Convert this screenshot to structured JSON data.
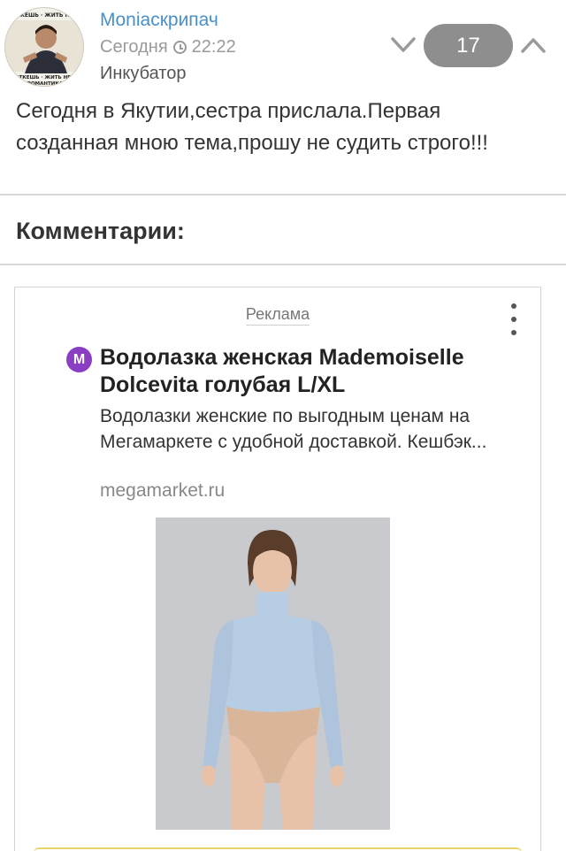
{
  "post": {
    "author": "Moniаскрипач",
    "date": "Сегодня",
    "time": "22:22",
    "community": "Инкубатор",
    "score": "17",
    "text": "Сегодня в Якутии,сестра прислала.Первая созданная мною тема,прошу не судить строго!!!",
    "avatar_caption": "ТЕОТЕКЕШЬ · ЖИТЬ НЕВОЗ. · РОМАНТИКА"
  },
  "comments": {
    "title": "Комментарии:"
  },
  "ad": {
    "label": "Реклама",
    "brand_letter": "M",
    "title": "Водолазка женская Mademoiselle Dolcevita голубая L/XL",
    "description": "Водолазки женские по выгодным ценам на Мегамаркете с удобной доставкой. Кешбэк...",
    "domain": "megamarket.ru"
  },
  "icons": {
    "vote_down": "chevron-down-icon",
    "vote_up": "chevron-up-icon",
    "clock": "clock-icon",
    "menu": "more-vertical-icon",
    "brand": "megamarket-logo-icon"
  },
  "colors": {
    "author": "#4a90c8",
    "score_bg": "#8e8e8e",
    "brand": "#8a3ec4",
    "sweater": "#b7cde4"
  }
}
